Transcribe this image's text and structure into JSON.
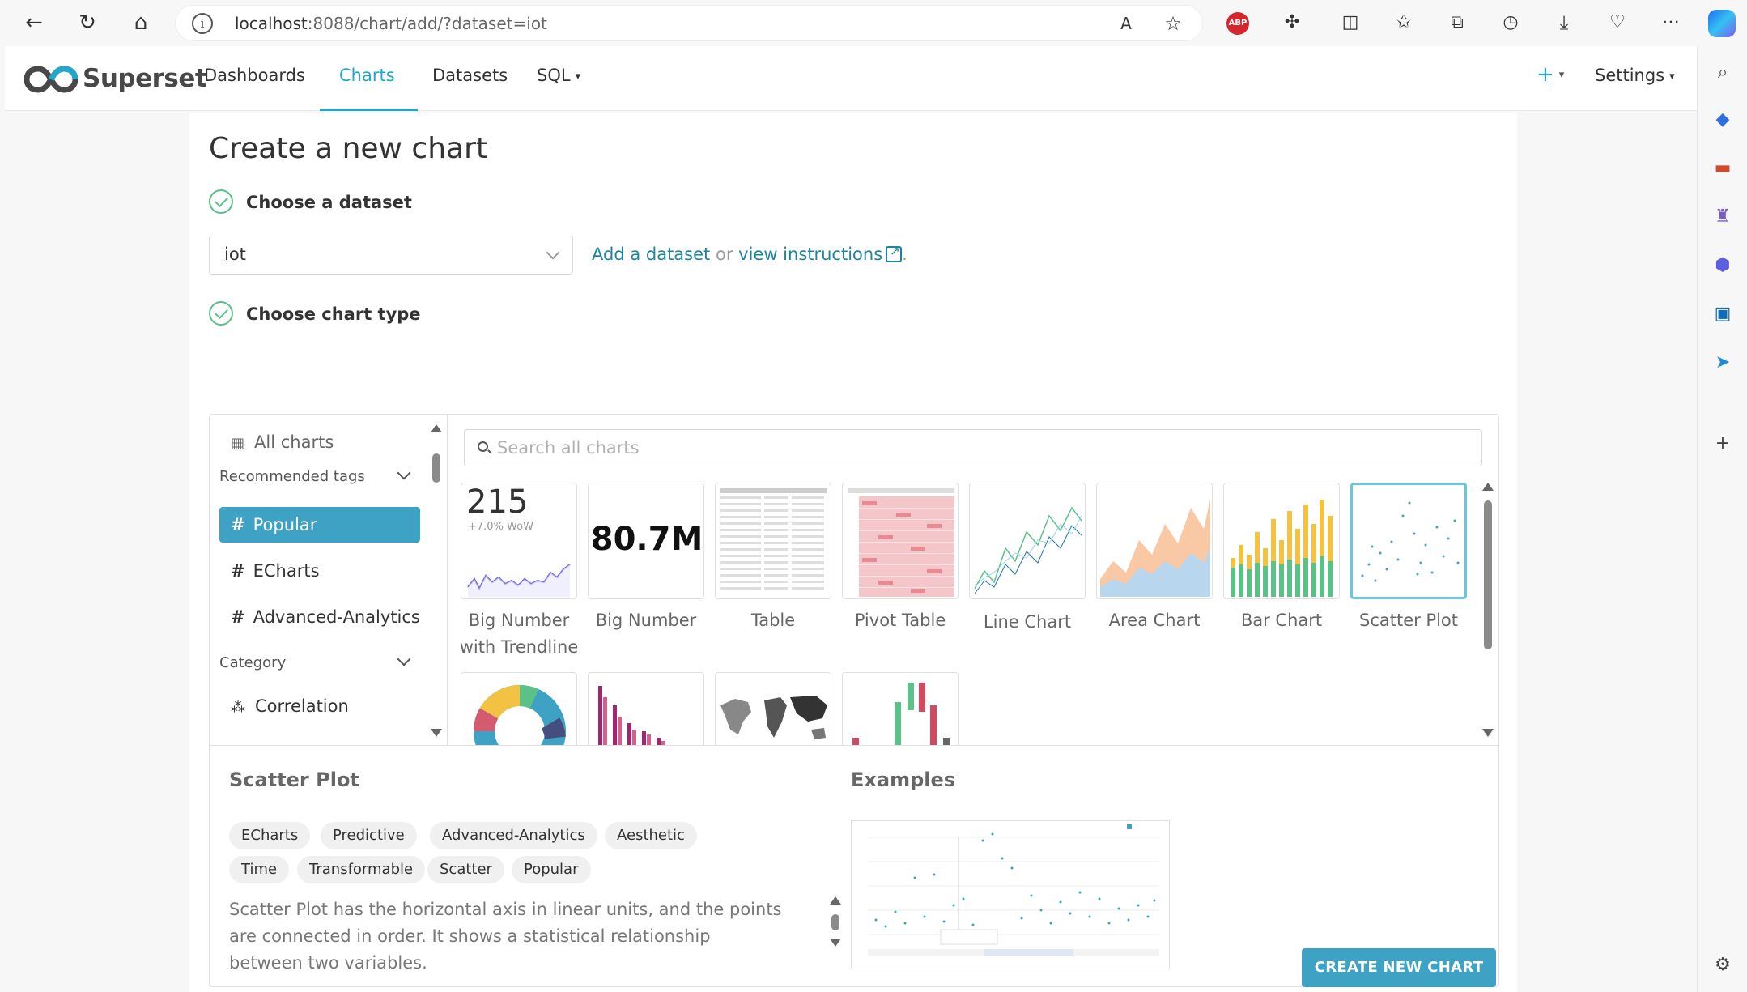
{
  "browser": {
    "url_host": "localhost",
    "url_rest": ":8088/chart/add/?dataset=iot",
    "abp_label": "ABP"
  },
  "navbar": {
    "brand": "Superset",
    "items": [
      "Dashboards",
      "Charts",
      "Datasets",
      "SQL"
    ],
    "active": "Charts",
    "plus_label": "+",
    "settings_label": "Settings"
  },
  "page": {
    "title": "Create a new chart",
    "step1_title": "Choose a dataset",
    "dataset_value": "iot",
    "add_dataset_link": "Add a dataset",
    "or_text": "or",
    "instructions_link": "view instructions",
    "period": ".",
    "step2_title": "Choose chart type"
  },
  "picker": {
    "all_charts": "All charts",
    "recommended_tags_label": "Recommended tags",
    "tags": [
      "Popular",
      "ECharts",
      "Advanced-Analytics"
    ],
    "category_label": "Category",
    "category_first": "Correlation",
    "search_placeholder": "Search all charts",
    "charts": [
      {
        "label_line1": "Big Number",
        "label_line2": "with Trendline",
        "thumb_value": "215",
        "thumb_sub": "+7.0% WoW"
      },
      {
        "label_line1": "Big Number",
        "label_line2": "",
        "thumb_value": "80.7M"
      },
      {
        "label_line1": "Table",
        "label_line2": ""
      },
      {
        "label_line1": "Pivot Table",
        "label_line2": ""
      },
      {
        "label_line1": "Line Chart",
        "label_line2": ""
      },
      {
        "label_line1": "Area Chart",
        "label_line2": ""
      },
      {
        "label_line1": "Bar Chart",
        "label_line2": ""
      },
      {
        "label_line1": "Scatter Plot",
        "label_line2": ""
      }
    ],
    "selected_chart": "Scatter Plot"
  },
  "details": {
    "name": "Scatter Plot",
    "examples_label": "Examples",
    "tags": [
      "ECharts",
      "Predictive",
      "Advanced-Analytics",
      "Aesthetic",
      "Time",
      "Transformable",
      "Scatter",
      "Popular"
    ],
    "description": "Scatter Plot has the horizontal axis in linear units, and the points are connected in order. It shows a statistical relationship between two variables."
  },
  "create_button": "CREATE NEW CHART",
  "colors": {
    "accent": "#20a7c9",
    "primary_button": "#3ea2c5",
    "check_green": "#5ac189",
    "link": "#1a85a0"
  }
}
